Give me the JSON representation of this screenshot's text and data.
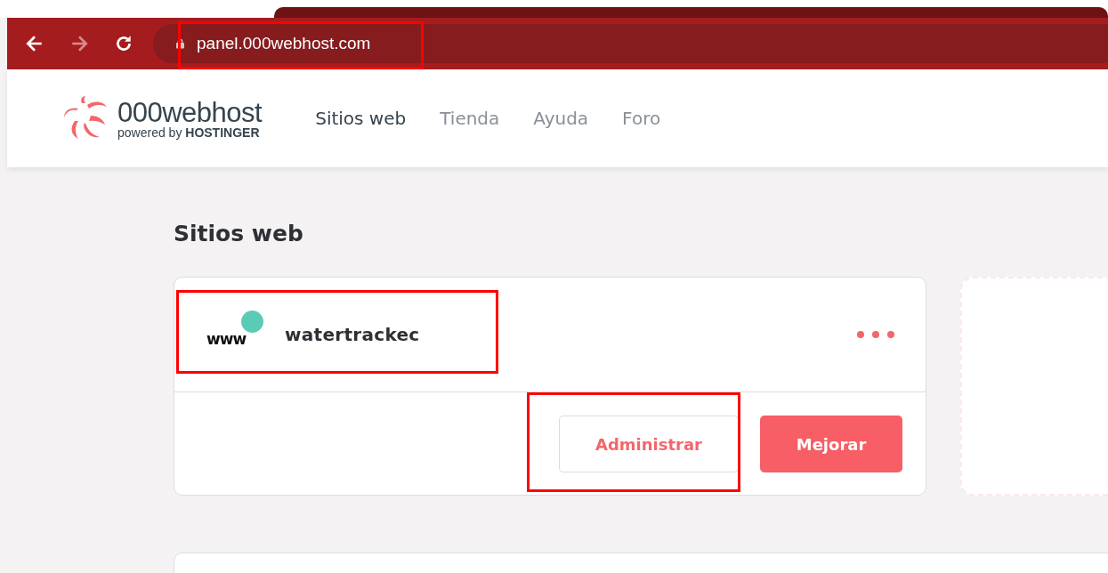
{
  "browser": {
    "url": "panel.000webhost.com"
  },
  "header": {
    "logo": {
      "name": "000webhost",
      "tagline": "powered by **HOSTINGER**"
    },
    "nav": [
      {
        "label": "Sitios web",
        "selected": true
      },
      {
        "label": "Tienda",
        "selected": false
      },
      {
        "label": "Ayuda",
        "selected": false
      },
      {
        "label": "Foro",
        "selected": false
      }
    ]
  },
  "page_title": "Sitios web",
  "sites": [
    {
      "prefix": "www",
      "color": "#5ccbb5",
      "name": "watertrackec",
      "buttons": [
        {
          "label": "Administrar",
          "kind": "outline"
        },
        {
          "label": "Mejorar",
          "kind": "primary"
        }
      ]
    }
  ]
}
